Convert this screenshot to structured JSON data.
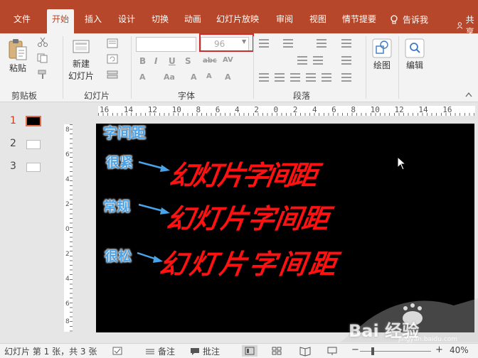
{
  "tabs": [
    "文件",
    "开始",
    "插入",
    "设计",
    "切换",
    "动画",
    "幻灯片放映",
    "审阅",
    "视图",
    "情节提要"
  ],
  "active_tab": "开始",
  "tell_me": "告诉我",
  "share": "共享",
  "ribbon": {
    "paste_label": "粘贴",
    "new_slide_label_1": "新建",
    "new_slide_label_2": "幻灯片",
    "font_size_value": "96",
    "font_name_value": "",
    "drawing_label": "绘图",
    "editing_label": "编辑",
    "groups": {
      "clipboard": "剪贴板",
      "slides": "幻灯片",
      "font": "字体",
      "paragraph": "段落"
    }
  },
  "slides": [
    {
      "number": "1",
      "current": true
    },
    {
      "number": "2",
      "current": false
    },
    {
      "number": "3",
      "current": false
    }
  ],
  "ruler": {
    "h_marks": "16 14 12 10 8 6 4 2 0 2 4 6 8 10 12 14 16",
    "v_marks": [
      "8",
      "6",
      "4",
      "2",
      "0",
      "2",
      "4",
      "6",
      "8"
    ]
  },
  "slide_content": {
    "title": "字间距",
    "rows": [
      {
        "label": "很紧",
        "text": "幻灯片字间距",
        "spacing": "tight"
      },
      {
        "label": "常规",
        "text": "幻灯片字间距",
        "spacing": "normal"
      },
      {
        "label": "很松",
        "text": "幻灯片字间距",
        "spacing": "loose"
      }
    ]
  },
  "statusbar": {
    "slide_info": "幻灯片 第 1 张，共 3 张",
    "notes": "备注",
    "comments": "批注",
    "zoom": "40%"
  },
  "watermark": {
    "text": "Bai 经验",
    "url": "jingyan.baidu.com"
  },
  "colors": {
    "accent": "#b7472a",
    "slide_bg": "#000000",
    "big_text": "#ff1111",
    "label_text": "#4aa3e8",
    "highlight_box": "#d02c2c"
  }
}
